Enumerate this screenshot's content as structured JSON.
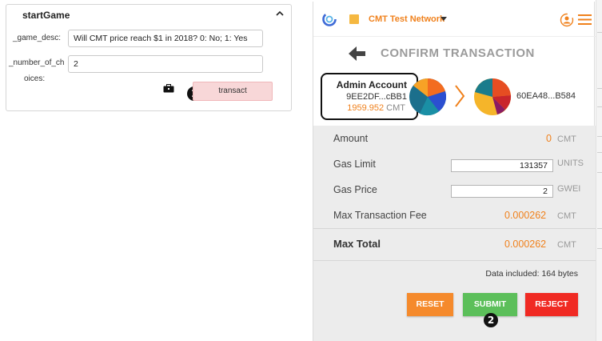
{
  "left_panel": {
    "title": "startGame",
    "param1_label": "_game_desc:",
    "param1_value": "Will CMT price reach $1 in 2018? 0: No; 1: Yes",
    "param2_label_line1": "_number_of_ch",
    "param2_label_line2": "oices:",
    "param2_value": "2",
    "transact_label": "transact",
    "marker1": "1"
  },
  "wallet": {
    "network_name": "CMT Test Network",
    "title": "CONFIRM TRANSACTION",
    "from": {
      "name": "Admin Account",
      "address": "9EE2DF...cBB1",
      "balance": "1959.952",
      "balance_unit": "CMT"
    },
    "to_address": "60EA48...B584",
    "rows": {
      "amount_label": "Amount",
      "amount_value": "0",
      "amount_unit": "CMT",
      "gas_limit_label": "Gas Limit",
      "gas_limit_value": "131357",
      "gas_limit_unit": "UNITS",
      "gas_price_label": "Gas Price",
      "gas_price_value": "2",
      "gas_price_unit": "GWEI",
      "max_fee_label": "Max Transaction Fee",
      "max_fee_value": "0.000262",
      "max_fee_unit": "CMT",
      "max_total_label": "Max Total",
      "max_total_value": "0.000262",
      "max_total_unit": "CMT"
    },
    "data_included": "Data included: 164 bytes",
    "buttons": {
      "reset": "RESET",
      "submit": "SUBMIT",
      "reject": "REJECT"
    },
    "marker2": "2"
  },
  "colors": {
    "accent_orange": "#f0811c",
    "reset": "#f58a2c",
    "submit": "#5cbf5a",
    "reject": "#f02a23",
    "transact_bg": "#f8d7d8"
  },
  "icons": [
    "chevron-up-icon",
    "briefcase-icon",
    "wallet-logo-icon",
    "network-dropdown-icon",
    "account-icon",
    "menu-icon",
    "back-arrow-icon",
    "chevron-right-icon",
    "identicon"
  ]
}
